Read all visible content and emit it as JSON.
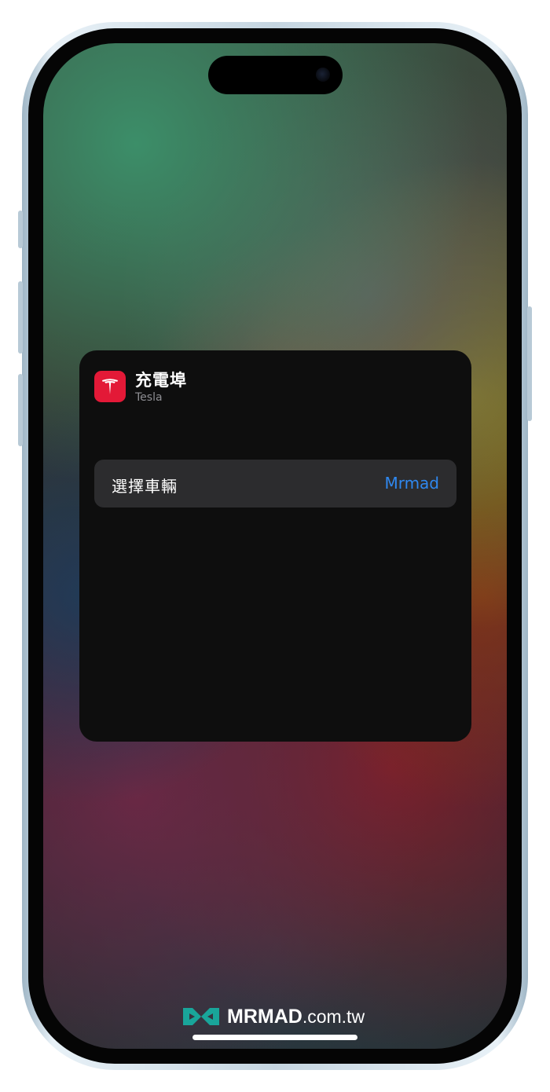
{
  "widget": {
    "app_name": "充電埠",
    "app_developer": "Tesla",
    "icon": "tesla-logo-icon",
    "accent_color": "#e31937",
    "parameter": {
      "label": "選擇車輛",
      "value": "Mrmad",
      "value_color": "#2f88f0"
    }
  },
  "watermark": {
    "brand": "MRMAD",
    "domain": ".com.tw",
    "icon": "mrmad-logo-icon"
  }
}
